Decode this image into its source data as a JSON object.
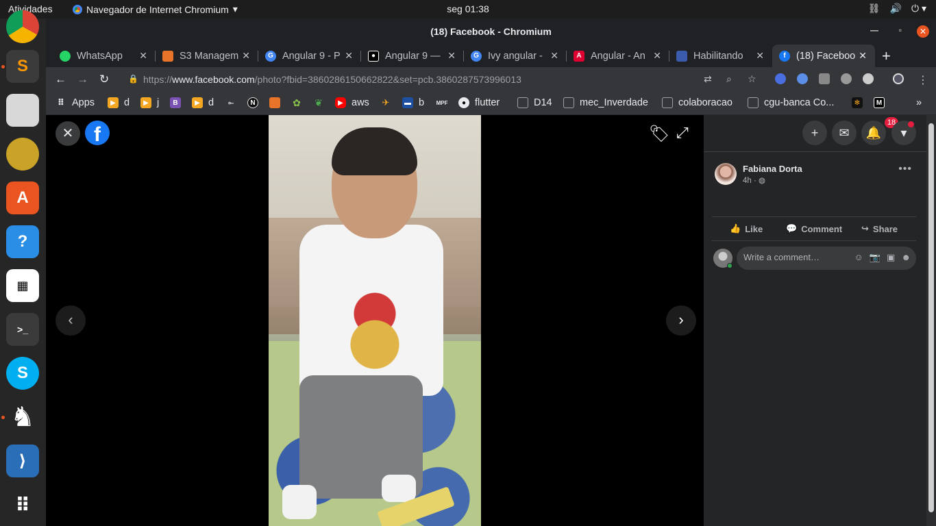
{
  "topbar": {
    "activities": "Atividades",
    "app_menu": "Navegador de Internet Chromium",
    "clock": "seg 01:38"
  },
  "window": {
    "title": "(18) Facebook - Chromium"
  },
  "tabs": [
    {
      "label": "WhatsApp",
      "color": "#25d366"
    },
    {
      "label": "S3 Managem",
      "color": "#e8742a"
    },
    {
      "label": "Angular 9 - P",
      "color": "#4285f4"
    },
    {
      "label": "Angular 9 —",
      "color": "#000000"
    },
    {
      "label": "Ivy angular -",
      "color": "#4285f4"
    },
    {
      "label": "Angular - An",
      "color": "#dd0031"
    },
    {
      "label": "Habilitando",
      "color": "#3b5cad"
    },
    {
      "label": "(18) Faceboo",
      "color": "#1877f2"
    }
  ],
  "address_bar": {
    "url_prefix": "https://",
    "url_host": "www.facebook.com",
    "url_path": "/photo?fbid=3860286150662822&set=pcb.3860287573996013"
  },
  "bookmarks": [
    {
      "label": "Apps",
      "icon": "apps-grid-icon"
    },
    {
      "label": "d",
      "icon": "play-icon"
    },
    {
      "label": "j",
      "icon": "play-icon"
    },
    {
      "label": "",
      "icon": "bootstrap-icon"
    },
    {
      "label": "d",
      "icon": "play-icon"
    },
    {
      "label": "",
      "icon": "link-icon"
    },
    {
      "label": "",
      "icon": "n-logo-icon"
    },
    {
      "label": "",
      "icon": "cube-icon"
    },
    {
      "label": "",
      "icon": "gear-icon"
    },
    {
      "label": "",
      "icon": "leaf-icon"
    },
    {
      "label": "aws",
      "icon": "youtube-icon"
    },
    {
      "label": "",
      "icon": "plane-icon"
    },
    {
      "label": "b",
      "icon": "flag-icon"
    },
    {
      "label": "",
      "icon": "mpf-icon"
    },
    {
      "label": "flutter",
      "icon": "github-icon"
    },
    {
      "label": "D14",
      "icon": "doc-icon"
    },
    {
      "label": "mec_Inverdade",
      "icon": "doc-icon"
    },
    {
      "label": "colaboracao",
      "icon": "doc-icon"
    },
    {
      "label": "cgu-banca Co...",
      "icon": "doc-icon"
    }
  ],
  "post": {
    "author": "Fabiana Dorta",
    "time": "4h",
    "like_label": "Like",
    "comment_label": "Comment",
    "share_label": "Share",
    "comment_placeholder": "Write a comment…",
    "notifications_count": "18"
  }
}
